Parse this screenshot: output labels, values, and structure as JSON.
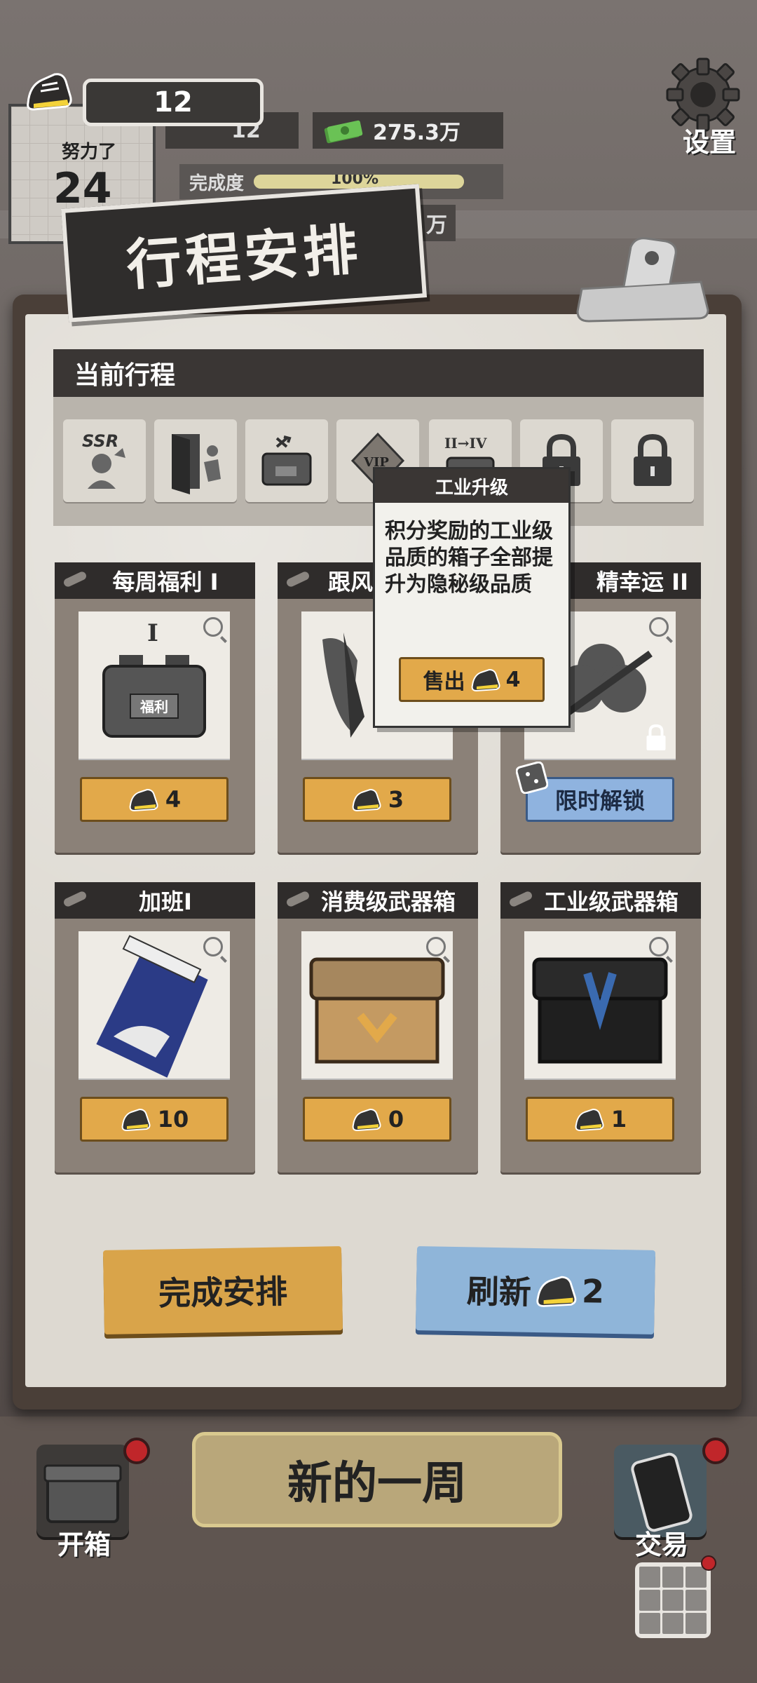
{
  "hud": {
    "shoe_count": "12",
    "shoe_count_small": "12",
    "money": "275.3万",
    "effort_label": "努力了",
    "effort_days": "24",
    "completion_label": "完成度",
    "completion_value": "100%",
    "completion_fraction": 1.0,
    "hidden_amount": "万",
    "settings_label": "设置"
  },
  "title": "行程安排",
  "current_schedule": {
    "header": "当前行程",
    "slots": [
      {
        "label": "SSR",
        "icon": "ssr-figure-icon"
      },
      {
        "label": "",
        "icon": "door-exit-icon"
      },
      {
        "label": "",
        "icon": "shuffle-box-icon"
      },
      {
        "label": "VIP",
        "icon": "vip-diamond-icon"
      },
      {
        "label": "II→IV",
        "icon": "upgrade-box-icon"
      },
      {
        "label": "",
        "icon": "lock-icon"
      },
      {
        "label": "",
        "icon": "lock-icon"
      }
    ]
  },
  "tooltip": {
    "title": "工业升级",
    "body": "积分奖励的工业级品质的箱子全部提升为隐秘级品质",
    "sell_label": "售出",
    "sell_cost": "4"
  },
  "cards": [
    {
      "title": "每周福利 I",
      "cost": "4",
      "img_text": "I",
      "box_text": "福利",
      "type": "orange"
    },
    {
      "title": "跟风",
      "cost": "3",
      "type": "orange"
    },
    {
      "title": "精幸运 II",
      "cost": "限时解锁",
      "type": "blue"
    },
    {
      "title": "加班I",
      "cost": "10",
      "type": "orange"
    },
    {
      "title": "消费级武器箱",
      "cost": "0",
      "type": "orange"
    },
    {
      "title": "工业级武器箱",
      "cost": "1",
      "type": "orange"
    }
  ],
  "actions": {
    "finish_label": "完成安排",
    "refresh_label": "刷新",
    "refresh_cost": "2",
    "new_week_label": "新的一周",
    "open_box_label": "开箱",
    "trade_label": "交易"
  },
  "colors": {
    "orange_button": "#e2a94a",
    "blue_button": "#8fb3df",
    "dark_header": "#2f2c2b",
    "paper": "#ddd9d1"
  }
}
